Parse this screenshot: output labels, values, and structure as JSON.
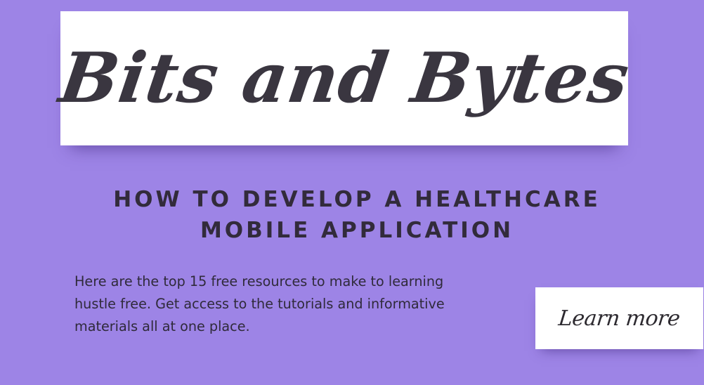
{
  "header": {
    "title": "Bits and Bytes"
  },
  "headline": {
    "line1": "How to develop a Healthcare",
    "line2": "Mobile Application"
  },
  "description": {
    "line1": "Here are the top 15 free resources to make to learning",
    "line2": "hustle free. Get access to the tutorials and informative",
    "line3": "materials all at one place."
  },
  "cta": {
    "label": "Learn more"
  },
  "colors": {
    "background": "#9d84e6",
    "card": "#ffffff",
    "text": "#322b3b"
  }
}
